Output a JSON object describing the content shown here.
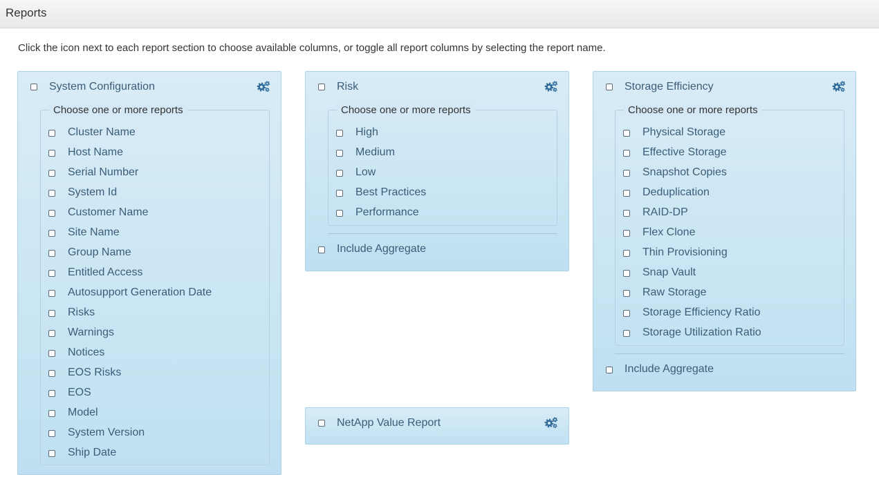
{
  "header": {
    "title": "Reports"
  },
  "instructions": "Click the icon next to each report section to choose available columns, or toggle all report columns by selecting the report name.",
  "legend_text": "Choose one or more reports",
  "panels": {
    "system": {
      "title": "System Configuration",
      "items": [
        "Cluster Name",
        "Host Name",
        "Serial Number",
        "System Id",
        "Customer Name",
        "Site Name",
        "Group Name",
        "Entitled Access",
        "Autosupport Generation Date",
        "Risks",
        "Warnings",
        "Notices",
        "EOS Risks",
        "EOS",
        "Model",
        "System Version",
        "Ship Date"
      ]
    },
    "risk": {
      "title": "Risk",
      "items": [
        "High",
        "Medium",
        "Low",
        "Best Practices",
        "Performance"
      ],
      "include_aggregate": "Include Aggregate"
    },
    "storage": {
      "title": "Storage Efficiency",
      "items": [
        "Physical Storage",
        "Effective Storage",
        "Snapshot Copies",
        "Deduplication",
        "RAID-DP",
        "Flex Clone",
        "Thin Provisioning",
        "Snap Vault",
        "Raw Storage",
        "Storage Efficiency Ratio",
        "Storage Utilization Ratio"
      ],
      "include_aggregate": "Include Aggregate"
    },
    "netapp": {
      "title": "NetApp Value Report"
    }
  },
  "icons": {
    "settings": "gears-icon",
    "checkbox": "checkbox-unchecked-icon"
  },
  "colors": {
    "label": "#3a5d78",
    "panel_top": "#d9ecf7",
    "panel_bottom": "#bfe0f1",
    "gear": "#2f6a99"
  }
}
